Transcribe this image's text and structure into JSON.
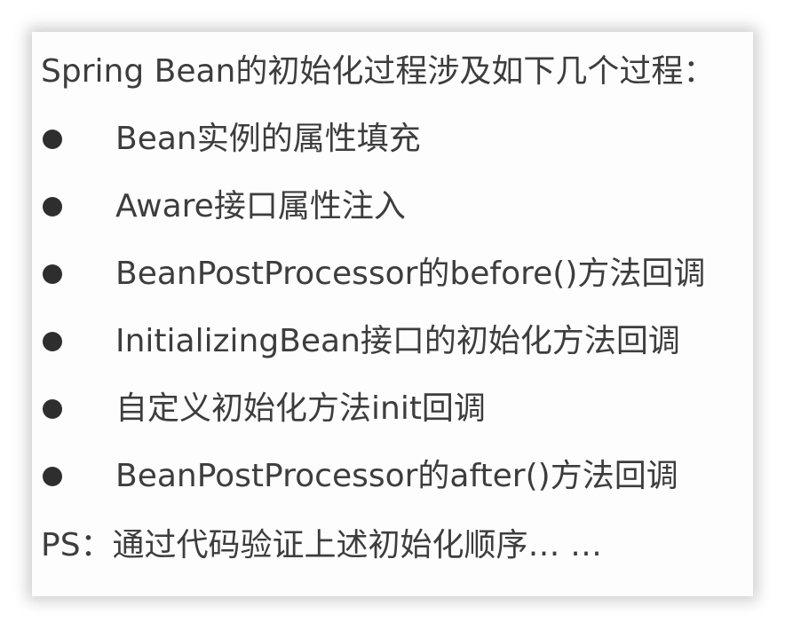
{
  "heading": "Spring Bean的初始化过程涉及如下几个过程：",
  "items": [
    "Bean实例的属性填充",
    "Aware接口属性注入",
    "BeanPostProcessor的before()方法回调",
    "InitializingBean接口的初始化方法回调",
    "自定义初始化方法init回调",
    "BeanPostProcessor的after()方法回调"
  ],
  "footer": "PS：通过代码验证上述初始化顺序… …"
}
